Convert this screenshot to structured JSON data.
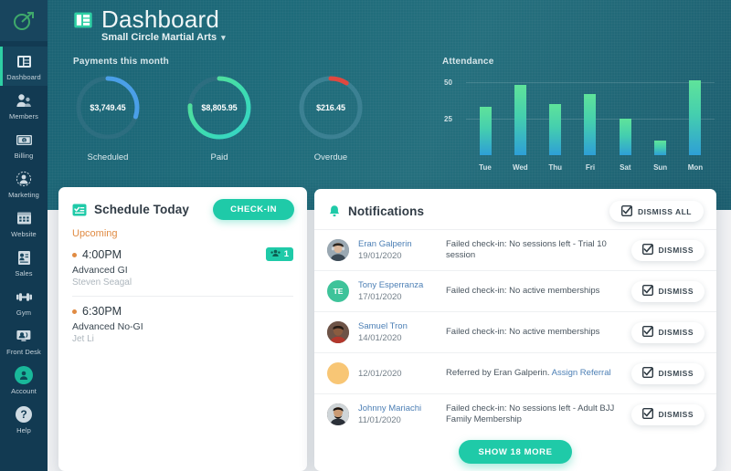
{
  "brand": {
    "logo_icon": "target-arrow-icon",
    "accent": "#1fcaa8",
    "sidebar_bg": "#123a52",
    "header_bg": "#1e6b7a"
  },
  "sidebar": {
    "items": [
      {
        "label": "Dashboard",
        "icon": "dashboard-icon",
        "active": true
      },
      {
        "label": "Members",
        "icon": "members-icon",
        "active": false
      },
      {
        "label": "Billing",
        "icon": "billing-icon",
        "active": false
      },
      {
        "label": "Marketing",
        "icon": "marketing-icon",
        "active": false
      },
      {
        "label": "Website",
        "icon": "website-icon",
        "active": false
      },
      {
        "label": "Sales",
        "icon": "sales-icon",
        "active": false
      },
      {
        "label": "Gym",
        "icon": "gym-icon",
        "active": false
      },
      {
        "label": "Front Desk",
        "icon": "front-desk-icon",
        "active": false
      },
      {
        "label": "Account",
        "icon": "account-icon",
        "active": false
      },
      {
        "label": "Help",
        "icon": "help-icon",
        "active": false
      }
    ]
  },
  "header": {
    "icon": "dashboard-icon",
    "title": "Dashboard",
    "org": "Small Circle Martial Arts",
    "caret": "⌄"
  },
  "payments": {
    "section_title": "Payments this month",
    "donuts": [
      {
        "value": "$3,749.45",
        "caption": "Scheduled",
        "percent": 30,
        "color_from": "#4a9fe8",
        "color_to": "#3f8fd8",
        "track": "#2d6e80"
      },
      {
        "value": "$8,805.95",
        "caption": "Paid",
        "percent": 76,
        "color_from": "#5ee08f",
        "color_to": "#35d4c8",
        "track": "#2d6e80"
      },
      {
        "value": "$216.45",
        "caption": "Overdue",
        "percent": 9,
        "color_from": "#e0483f",
        "color_to": "#d8453c",
        "track": "#3c8193"
      }
    ]
  },
  "chart_data": {
    "type": "bar",
    "title": "Attendance",
    "categories": [
      "Tue",
      "Wed",
      "Thu",
      "Fri",
      "Sat",
      "Sun",
      "Mon"
    ],
    "values": [
      33,
      48,
      35,
      42,
      25,
      10,
      51
    ],
    "yticks": [
      25,
      50
    ],
    "ylim": [
      0,
      55
    ],
    "xlabel": "",
    "ylabel": "",
    "grid": true,
    "legend": "none",
    "bar_gradient": [
      "#5fe39a",
      "#2e9fd6"
    ]
  },
  "schedule": {
    "icon": "schedule-icon",
    "title": "Schedule Today",
    "checkin_label": "CHECK-IN",
    "upcoming_label": "Upcoming",
    "items": [
      {
        "time": "4:00PM",
        "class_name": "Advanced GI",
        "coach": "Steven Seagal",
        "count": "1",
        "count_icon": "people-icon"
      },
      {
        "time": "6:30PM",
        "class_name": "Advanced No-GI",
        "coach": "Jet Li",
        "count": "",
        "count_icon": ""
      }
    ]
  },
  "notifications": {
    "icon": "bell-icon",
    "title": "Notifications",
    "dismiss_all_label": "DISMISS ALL",
    "dismiss_label": "DISMISS",
    "dismiss_icon": "checkbox-check-icon",
    "show_more_label": "SHOW 18 MORE",
    "rows": [
      {
        "name": "Eran Galperin",
        "date": "19/01/2020",
        "message": "Failed check-in: No sessions left - Trial 10 session",
        "link": "",
        "avatar_type": "photo",
        "avatar_color": "#6d7b86",
        "initials": ""
      },
      {
        "name": "Tony Esperranza",
        "date": "17/01/2020",
        "message": "Failed check-in: No active memberships",
        "link": "",
        "avatar_type": "initials",
        "avatar_color": "#3ec39a",
        "initials": "TE"
      },
      {
        "name": "Samuel Tron",
        "date": "14/01/2020",
        "message": "Failed check-in: No active memberships",
        "link": "",
        "avatar_type": "photo",
        "avatar_color": "#7a5a4c",
        "initials": ""
      },
      {
        "name": "",
        "date": "12/01/2020",
        "message": "Referred by Eran Galperin.",
        "link": "Assign Referral",
        "avatar_type": "blank",
        "avatar_color": "#f8c675",
        "initials": ""
      },
      {
        "name": "Johnny Mariachi",
        "date": "11/01/2020",
        "message": "Failed check-in: No sessions left - Adult BJJ Family Membership",
        "link": "",
        "avatar_type": "photo",
        "avatar_color": "#4a3c38",
        "initials": ""
      }
    ]
  }
}
